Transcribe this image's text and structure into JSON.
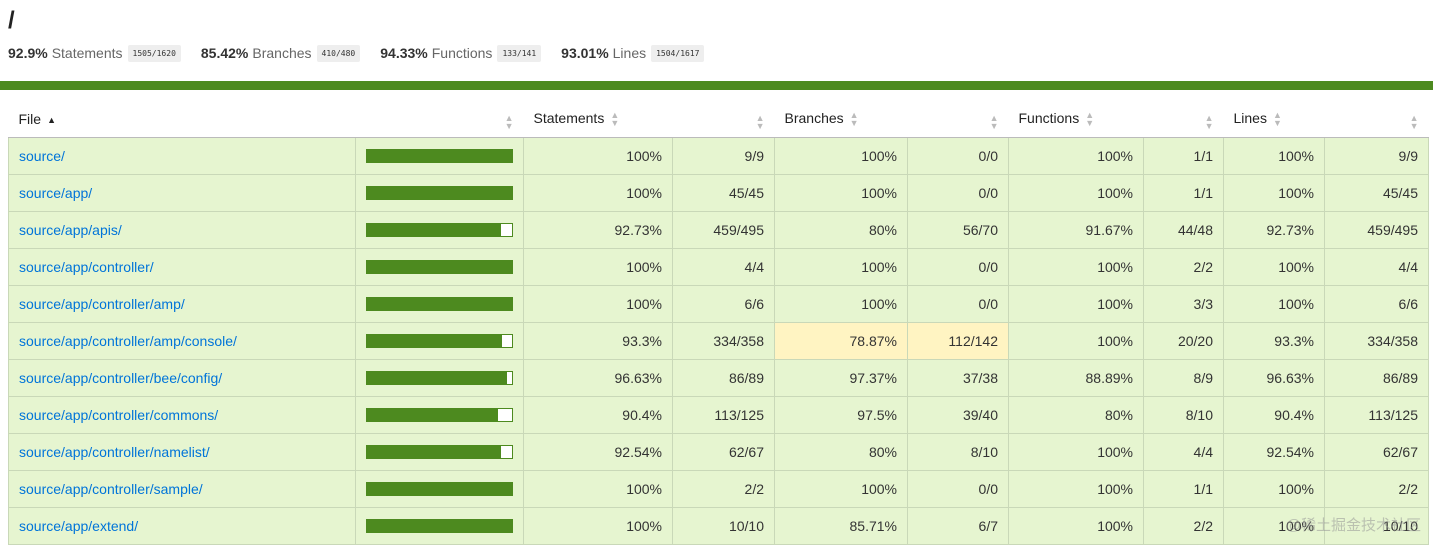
{
  "page_title": "/",
  "summary": [
    {
      "pct": "92.9%",
      "label": "Statements",
      "fraction": "1505/1620"
    },
    {
      "pct": "85.42%",
      "label": "Branches",
      "fraction": "410/480"
    },
    {
      "pct": "94.33%",
      "label": "Functions",
      "fraction": "133/141"
    },
    {
      "pct": "93.01%",
      "label": "Lines",
      "fraction": "1504/1617"
    }
  ],
  "status_color": "#4d8a1f",
  "colors": {
    "high_bg": "#e6f5d0",
    "medium_bg": "#fff4c2",
    "bar_fill": "#4d8a1f",
    "link": "#0074d9"
  },
  "headers": {
    "file": "File",
    "statements": "Statements",
    "branches": "Branches",
    "functions": "Functions",
    "lines": "Lines"
  },
  "rows": [
    {
      "file": "source/",
      "coverage": 1.0,
      "st_pct": "100%",
      "st_frac": "9/9",
      "br_pct": "100%",
      "br_frac": "0/0",
      "fn_pct": "100%",
      "fn_frac": "1/1",
      "ln_pct": "100%",
      "ln_frac": "9/9",
      "br_level": "high"
    },
    {
      "file": "source/app/",
      "coverage": 1.0,
      "st_pct": "100%",
      "st_frac": "45/45",
      "br_pct": "100%",
      "br_frac": "0/0",
      "fn_pct": "100%",
      "fn_frac": "1/1",
      "ln_pct": "100%",
      "ln_frac": "45/45",
      "br_level": "high"
    },
    {
      "file": "source/app/apis/",
      "coverage": 0.9273,
      "st_pct": "92.73%",
      "st_frac": "459/495",
      "br_pct": "80%",
      "br_frac": "56/70",
      "fn_pct": "91.67%",
      "fn_frac": "44/48",
      "ln_pct": "92.73%",
      "ln_frac": "459/495",
      "br_level": "high"
    },
    {
      "file": "source/app/controller/",
      "coverage": 1.0,
      "st_pct": "100%",
      "st_frac": "4/4",
      "br_pct": "100%",
      "br_frac": "0/0",
      "fn_pct": "100%",
      "fn_frac": "2/2",
      "ln_pct": "100%",
      "ln_frac": "4/4",
      "br_level": "high"
    },
    {
      "file": "source/app/controller/amp/",
      "coverage": 1.0,
      "st_pct": "100%",
      "st_frac": "6/6",
      "br_pct": "100%",
      "br_frac": "0/0",
      "fn_pct": "100%",
      "fn_frac": "3/3",
      "ln_pct": "100%",
      "ln_frac": "6/6",
      "br_level": "high"
    },
    {
      "file": "source/app/controller/amp/console/",
      "coverage": 0.933,
      "st_pct": "93.3%",
      "st_frac": "334/358",
      "br_pct": "78.87%",
      "br_frac": "112/142",
      "fn_pct": "100%",
      "fn_frac": "20/20",
      "ln_pct": "93.3%",
      "ln_frac": "334/358",
      "br_level": "medium"
    },
    {
      "file": "source/app/controller/bee/config/",
      "coverage": 0.9663,
      "st_pct": "96.63%",
      "st_frac": "86/89",
      "br_pct": "97.37%",
      "br_frac": "37/38",
      "fn_pct": "88.89%",
      "fn_frac": "8/9",
      "ln_pct": "96.63%",
      "ln_frac": "86/89",
      "br_level": "high"
    },
    {
      "file": "source/app/controller/commons/",
      "coverage": 0.904,
      "st_pct": "90.4%",
      "st_frac": "113/125",
      "br_pct": "97.5%",
      "br_frac": "39/40",
      "fn_pct": "80%",
      "fn_frac": "8/10",
      "ln_pct": "90.4%",
      "ln_frac": "113/125",
      "br_level": "high"
    },
    {
      "file": "source/app/controller/namelist/",
      "coverage": 0.9254,
      "st_pct": "92.54%",
      "st_frac": "62/67",
      "br_pct": "80%",
      "br_frac": "8/10",
      "fn_pct": "100%",
      "fn_frac": "4/4",
      "ln_pct": "92.54%",
      "ln_frac": "62/67",
      "br_level": "high"
    },
    {
      "file": "source/app/controller/sample/",
      "coverage": 1.0,
      "st_pct": "100%",
      "st_frac": "2/2",
      "br_pct": "100%",
      "br_frac": "0/0",
      "fn_pct": "100%",
      "fn_frac": "1/1",
      "ln_pct": "100%",
      "ln_frac": "2/2",
      "br_level": "high"
    },
    {
      "file": "source/app/extend/",
      "coverage": 1.0,
      "st_pct": "100%",
      "st_frac": "10/10",
      "br_pct": "85.71%",
      "br_frac": "6/7",
      "fn_pct": "100%",
      "fn_frac": "2/2",
      "ln_pct": "100%",
      "ln_frac": "10/10",
      "br_level": "high"
    }
  ],
  "watermark": "@稀土掘金技术社区"
}
